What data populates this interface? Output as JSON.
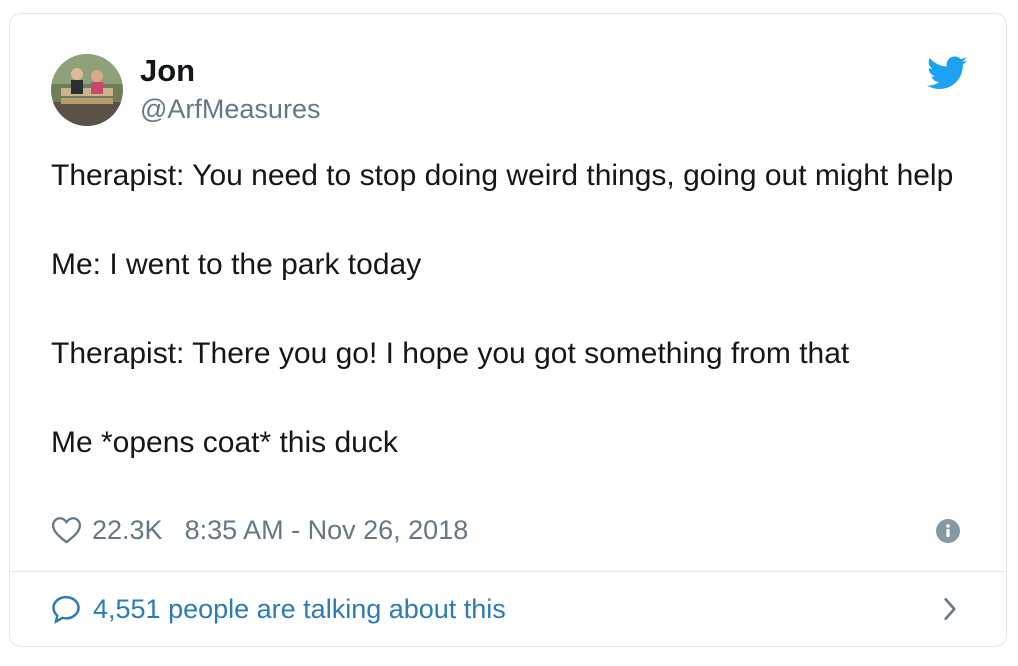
{
  "tweet": {
    "author": {
      "name": "Jon",
      "handle": "@ArfMeasures",
      "avatar_icon": "avatar-photo"
    },
    "brand": {
      "icon": "twitter-bird-icon",
      "color": "#1da1f2"
    },
    "paragraphs": [
      "Therapist: You need to stop doing weird things, going out might help",
      "Me: I went to the park today",
      "Therapist: There you go! I hope you got something from that",
      "Me *opens coat* this duck"
    ],
    "likes": "22.3K",
    "timestamp": "8:35 AM - Nov 26, 2018",
    "conversation": "4,551 people are talking about this"
  }
}
